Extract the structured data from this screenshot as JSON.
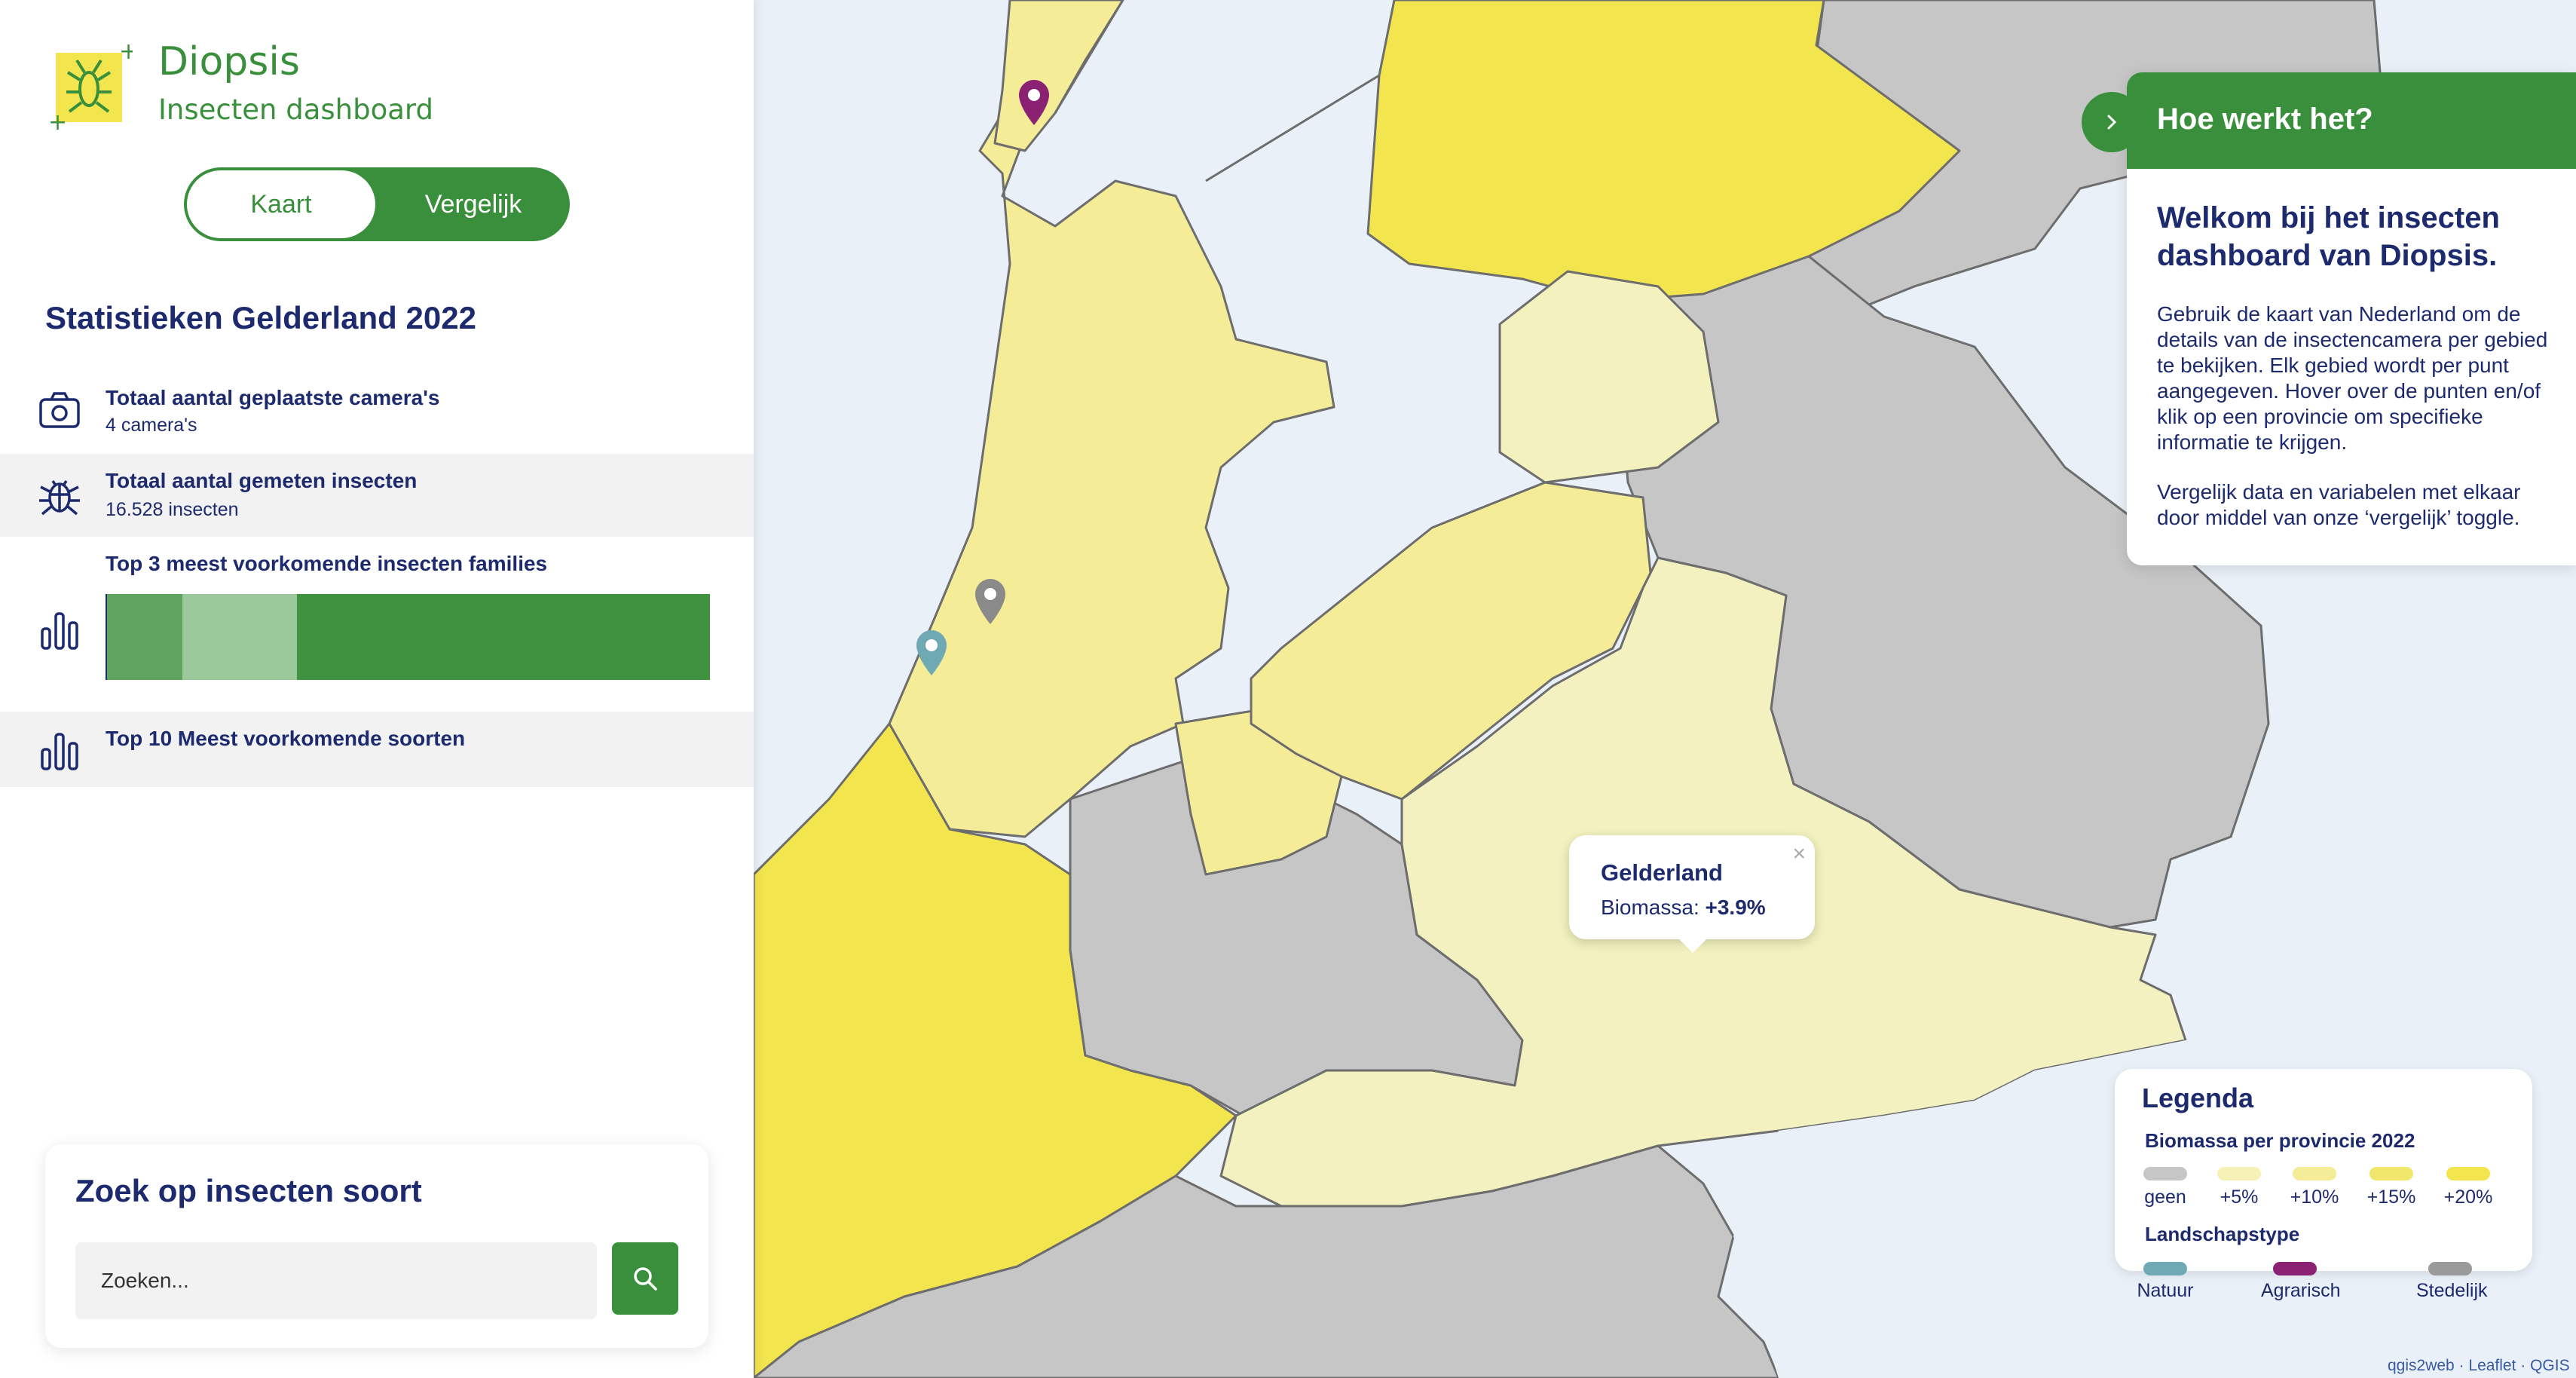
{
  "brand": {
    "name": "Diopsis",
    "subtitle": "Insecten dashboard"
  },
  "toggle": {
    "kaart_label": "Kaart",
    "vergelijk_label": "Vergelijk",
    "active": "Kaart"
  },
  "stats": {
    "title": "Statistieken Gelderland 2022",
    "cameras": {
      "label": "Totaal aantal geplaatste camera's",
      "value": "4 camera's",
      "icon": "camera-icon"
    },
    "insects": {
      "label": "Totaal aantal gemeten insecten",
      "value": "16.528 insecten",
      "icon": "bug-icon"
    },
    "families": {
      "label": "Top 3 meest voorkomende insecten families",
      "icon": "bar-chart-icon",
      "segments": [
        {
          "share": 0.125,
          "color": "#5fa55f"
        },
        {
          "share": 0.19,
          "color": "#9cc99b"
        },
        {
          "share": 0.685,
          "color": "#3f9240"
        }
      ]
    },
    "species": {
      "label": "Top 10 Meest voorkomende soorten",
      "icon": "bar-chart-icon"
    }
  },
  "search": {
    "title": "Zoek op insecten soort",
    "placeholder": "Zoeken...",
    "button_icon": "search-icon"
  },
  "popup": {
    "title": "Gelderland",
    "label": "Biomassa:",
    "value": "+3.9%",
    "close": "×"
  },
  "info": {
    "tab_icon": "chevron-right-icon",
    "title": "Hoe werkt het?",
    "heading": "Welkom bij het insecten dashboard van Diopsis.",
    "paragraph1": "Gebruik de kaart van Nederland om de details van de insectencamera per gebied te bekijken. Elk gebied wordt per punt aangegeven. Hover over de punten en/of klik op een provincie om specifieke informatie te krijgen.",
    "paragraph2": "Vergelijk data en variabelen met elkaar door middel van onze ‘vergelijk’ toggle."
  },
  "legend": {
    "title": "Legenda",
    "biomass_title": "Biomassa per provincie 2022",
    "biomass_items": [
      {
        "label": "geen",
        "color": "#c6c6c6"
      },
      {
        "label": "+5%",
        "color": "#f6f1b6"
      },
      {
        "label": "+10%",
        "color": "#f4ec96"
      },
      {
        "label": "+15%",
        "color": "#f2e76d"
      },
      {
        "label": "+20%",
        "color": "#f2e54e"
      }
    ],
    "landscape_title": "Landschapstype",
    "landscape_items": [
      {
        "label": "Natuur",
        "color": "#6fa9b4"
      },
      {
        "label": "Agrarisch",
        "color": "#8b2172"
      },
      {
        "label": "Stedelijk",
        "color": "#9a9a9a"
      }
    ]
  },
  "markers": [
    {
      "type": "Agrarisch",
      "color": "#8b2172"
    },
    {
      "type": "Stedelijk",
      "color": "#8a8a8a"
    },
    {
      "type": "Natuur",
      "color": "#6fa9b4"
    }
  ],
  "colors": {
    "brand_green": "#3a8f3c",
    "navy": "#1d2a6e",
    "water": "#e9f0f8",
    "gray": "#c6c6c6",
    "yellow_strong": "#f2e54e",
    "yellow_mid": "#f4ec96",
    "yellow_light": "#f3f1bd"
  },
  "attribution": "qgis2web · Leaflet · QGIS"
}
